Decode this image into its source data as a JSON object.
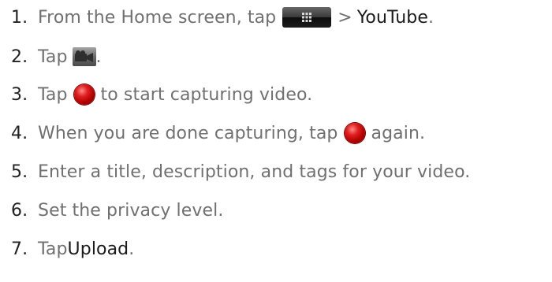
{
  "steps": [
    {
      "number": "1.",
      "text_before": "From the Home screen, tap",
      "icon": "all-apps-launcher-icon",
      "text_mid": "> ",
      "highlight": "YouTube",
      "text_after": "."
    },
    {
      "number": "2.",
      "text_before": "Tap",
      "icon": "video-camera-icon",
      "text_after": "."
    },
    {
      "number": "3.",
      "text_before": "Tap",
      "icon": "record-button-icon",
      "text_after": "to start capturing video."
    },
    {
      "number": "4.",
      "text_before": "When you are done capturing, tap",
      "icon": "record-button-icon",
      "text_after": "again."
    },
    {
      "number": "5.",
      "text_before": "Enter a title, description, and tags for your video."
    },
    {
      "number": "6.",
      "text_before": "Set the privacy level."
    },
    {
      "number": "7.",
      "text_before": "Tap ",
      "highlight": "Upload",
      "text_after": "."
    }
  ],
  "colors": {
    "body_text": "#707070",
    "number_text": "#222222",
    "highlight_text": "#1a1a1a",
    "record_red": "#d00000"
  }
}
